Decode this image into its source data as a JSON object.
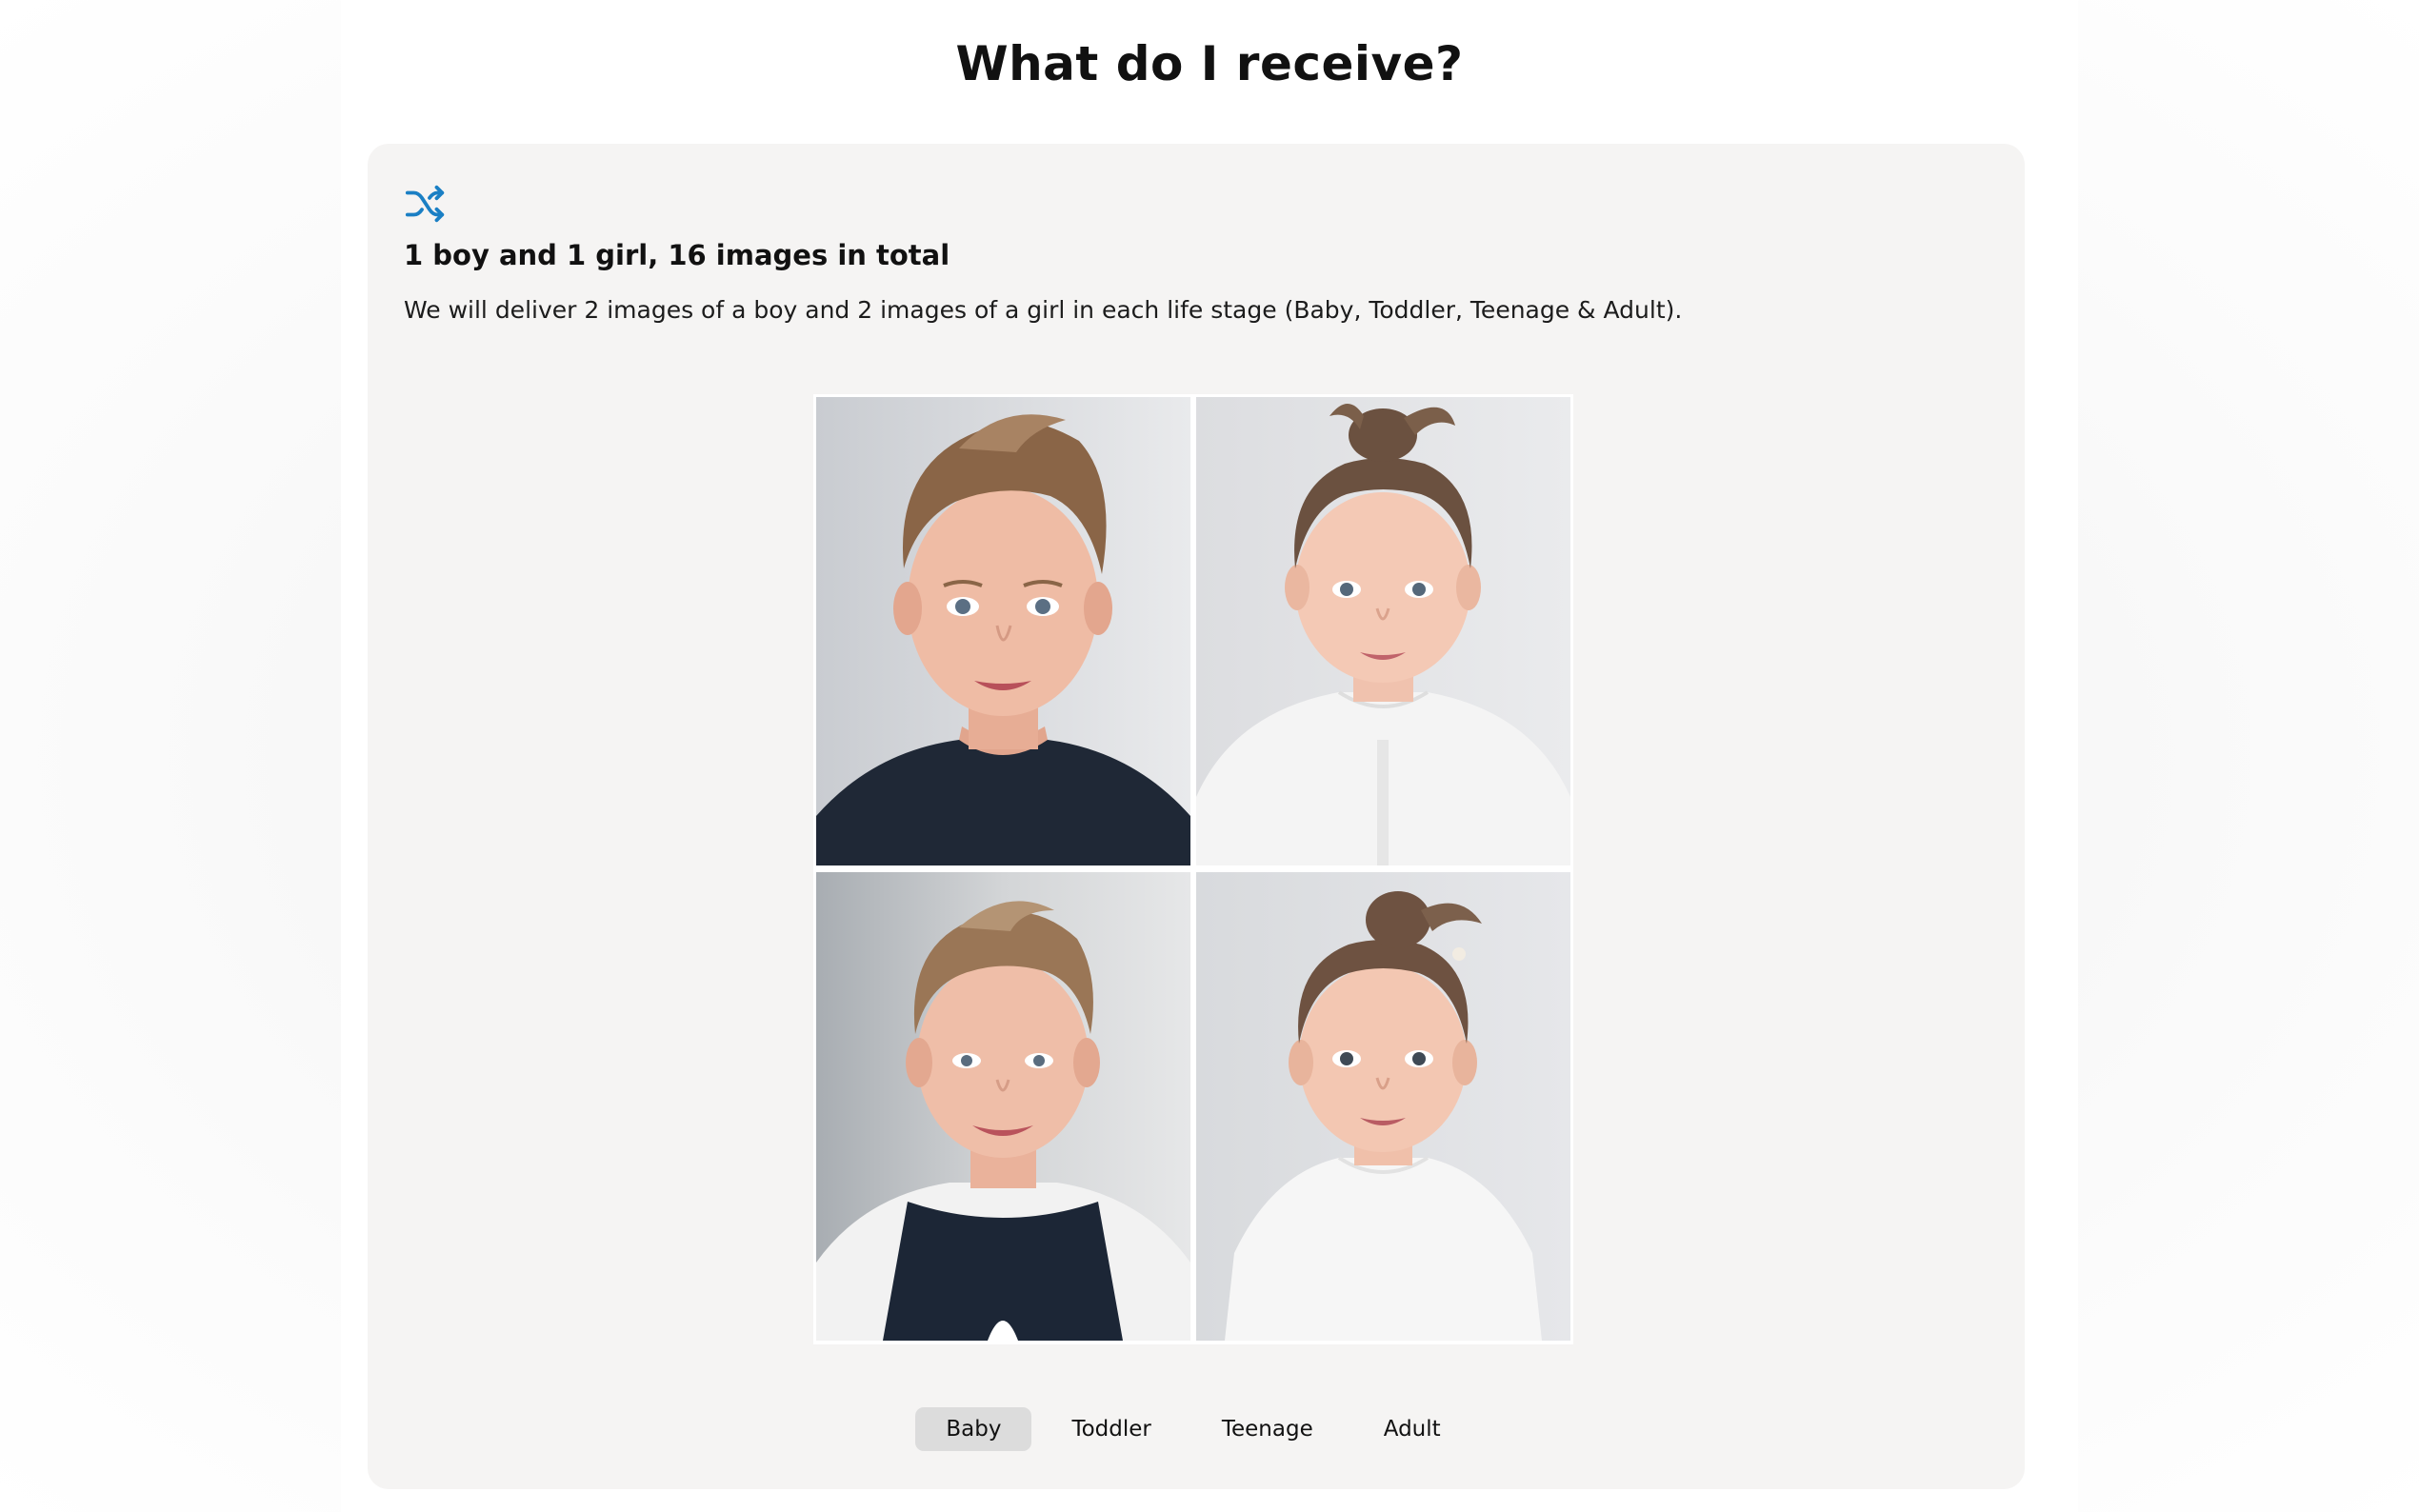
{
  "page": {
    "heading": "What do I receive?"
  },
  "option": {
    "icon": "shuffle-icon",
    "accent_color": "#1a7fc4",
    "title": "1 boy and 1 girl, 16 images in total",
    "description": "We will deliver 2 images of a boy and 2 images of a girl in each life stage (Baby, Toddler, Teenage & Adult)."
  },
  "gallery": {
    "images": [
      {
        "subject": "boy",
        "shirt_color": "#1f2836"
      },
      {
        "subject": "girl",
        "shirt_color": "#f4f4f4"
      },
      {
        "subject": "boy",
        "shirt_color": "#1c2636"
      },
      {
        "subject": "girl",
        "shirt_color": "#f6f6f6"
      }
    ]
  },
  "tabs": [
    {
      "label": "Baby",
      "active": true
    },
    {
      "label": "Toddler",
      "active": false
    },
    {
      "label": "Teenage",
      "active": false
    },
    {
      "label": "Adult",
      "active": false
    }
  ],
  "colors": {
    "card_background": "#f5f4f3",
    "active_tab_background": "#dcdcdc"
  }
}
